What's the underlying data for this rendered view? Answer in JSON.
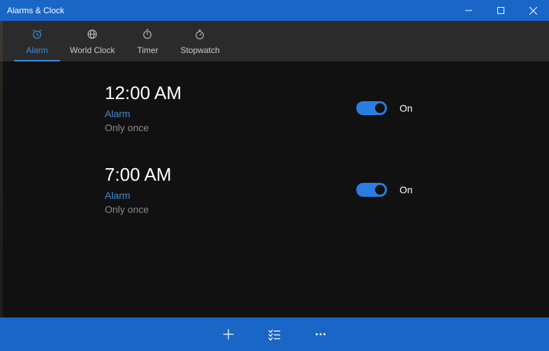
{
  "window": {
    "title": "Alarms & Clock"
  },
  "tabs": [
    {
      "label": "Alarm",
      "icon": "alarm",
      "active": true
    },
    {
      "label": "World Clock",
      "icon": "globe",
      "active": false
    },
    {
      "label": "Timer",
      "icon": "timer",
      "active": false
    },
    {
      "label": "Stopwatch",
      "icon": "stopwatch",
      "active": false
    }
  ],
  "alarms": [
    {
      "time": "12:00 AM",
      "name": "Alarm",
      "repeat": "Only once",
      "on": true,
      "toggle_label": "On"
    },
    {
      "time": "7:00 AM",
      "name": "Alarm",
      "repeat": "Only once",
      "on": true,
      "toggle_label": "On"
    }
  ],
  "bottombar": {
    "add": "add",
    "select": "select",
    "more": "more"
  }
}
